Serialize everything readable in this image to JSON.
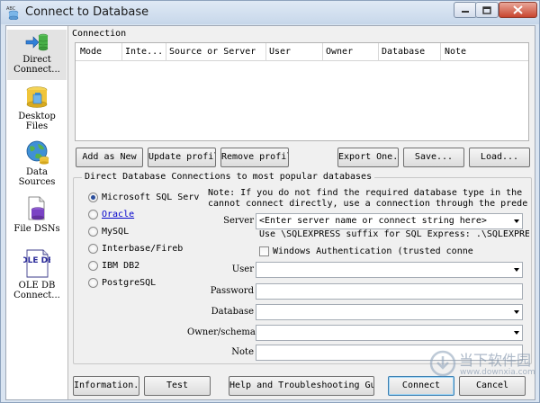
{
  "window": {
    "title": "Connect to Database"
  },
  "sidebar": {
    "items": [
      {
        "label": "Direct Connect...",
        "icon": "direct-connect-icon"
      },
      {
        "label": "Desktop Files",
        "icon": "desktop-files-icon"
      },
      {
        "label": "Data Sources",
        "icon": "data-sources-icon"
      },
      {
        "label": "File DSNs",
        "icon": "file-dsn-icon"
      },
      {
        "label": "OLE DB Connect...",
        "icon": "ole-db-icon",
        "icon_text": "OLE DB"
      }
    ]
  },
  "connection": {
    "label": "Connection",
    "columns": [
      "Mode",
      "Inte...",
      "Source or Server",
      "User",
      "Owner",
      "Database",
      "Note"
    ]
  },
  "buttons": {
    "add_as_new": "Add as New",
    "update_profile": "Update profile",
    "remove_profile": "Remove profile",
    "export_one": "Export One...",
    "save": "Save...",
    "load": "Load..."
  },
  "direct": {
    "group_title": "Direct Database Connections to most popular databases",
    "radios": [
      {
        "label": "Microsoft SQL Serv",
        "selected": true,
        "link": false
      },
      {
        "label": "Oracle",
        "selected": false,
        "link": true
      },
      {
        "label": "MySQL",
        "selected": false,
        "link": false
      },
      {
        "label": "Interbase/Fireb",
        "selected": false,
        "link": false
      },
      {
        "label": "IBM DB2",
        "selected": false,
        "link": false
      },
      {
        "label": "PostgreSQL",
        "selected": false,
        "link": false
      }
    ],
    "note_line1": "Note: If you do not find the required database type in the list or",
    "note_line2": "cannot connect directly, use a connection through the predefined"
  },
  "form": {
    "server_label": "Server",
    "server_placeholder": "<Enter server name or connect string here>",
    "server_hint": "Use \\SQLEXPRESS suffix for SQL Express: .\\SQLEXPRESS is",
    "windows_auth_label": "Windows Authentication (trusted conne",
    "user_label": "User",
    "user_value": "",
    "password_label": "Password",
    "password_value": "",
    "database_label": "Database",
    "database_value": "",
    "owner_label": "Owner/schema",
    "owner_value": "",
    "note_label": "Note",
    "note_value": ""
  },
  "footer": {
    "information": "Information...",
    "test": "Test",
    "help": "Help and Troubleshooting Guide",
    "connect": "Connect",
    "cancel": "Cancel"
  },
  "watermark": {
    "cn": "当下软件园",
    "url": "www.downxia.com"
  }
}
